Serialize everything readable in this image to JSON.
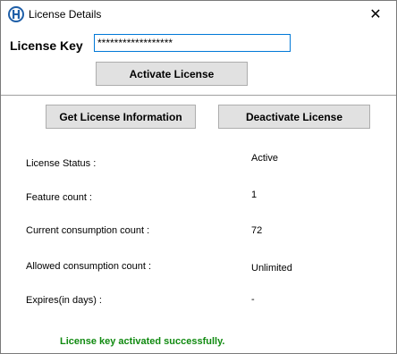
{
  "window": {
    "title": "License  Details",
    "close_glyph": "✕"
  },
  "license_key": {
    "label": "License Key",
    "value": "******************"
  },
  "buttons": {
    "activate": "Activate License",
    "get_info": "Get License Information",
    "deactivate": "Deactivate License"
  },
  "fields": [
    {
      "label": "License Status :",
      "value": "Active"
    },
    {
      "label": "Feature count  :",
      "value": "1"
    },
    {
      "label": "Current consumption count  :",
      "value": "72"
    },
    {
      "label": "Allowed consumption count  :",
      "value": "Unlimited"
    },
    {
      "label": "Expires(in days)  :",
      "value": "-"
    }
  ],
  "status_message": "License key activated successfully.",
  "colors": {
    "success": "#108a10",
    "input_border": "#0078d7",
    "button_bg": "#e1e1e1"
  }
}
